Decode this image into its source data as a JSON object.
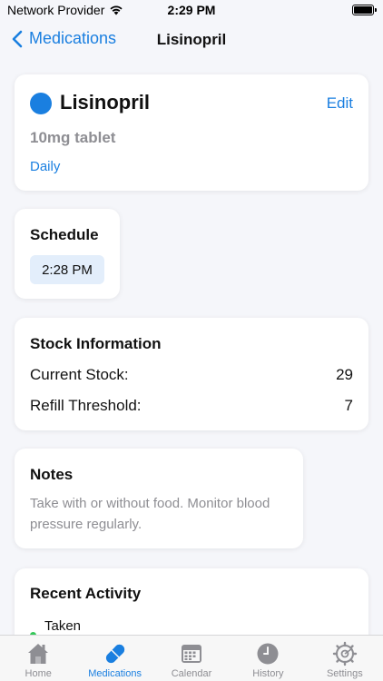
{
  "status_bar": {
    "carrier": "Network Provider",
    "time": "2:29 PM"
  },
  "nav": {
    "back_label": "Medications",
    "title": "Lisinopril"
  },
  "medication": {
    "name": "Lisinopril",
    "edit_label": "Edit",
    "dosage": "10mg tablet",
    "frequency": "Daily",
    "color": "#1a7fe0"
  },
  "schedule": {
    "title": "Schedule",
    "times": [
      "2:28 PM"
    ]
  },
  "stock": {
    "title": "Stock Information",
    "current_label": "Current Stock:",
    "current_value": "29",
    "threshold_label": "Refill Threshold:",
    "threshold_value": "7"
  },
  "notes": {
    "title": "Notes",
    "text": "Take with or without food. Monitor blood pressure regularly."
  },
  "activity": {
    "title": "Recent Activity",
    "items": [
      {
        "label": "Taken",
        "status_color": "#34c759"
      }
    ]
  },
  "tabs": [
    {
      "label": "Home",
      "icon": "house-icon",
      "active": false
    },
    {
      "label": "Medications",
      "icon": "pill-icon",
      "active": true
    },
    {
      "label": "Calendar",
      "icon": "calendar-icon",
      "active": false
    },
    {
      "label": "History",
      "icon": "clock-icon",
      "active": false
    },
    {
      "label": "Settings",
      "icon": "gear-icon",
      "active": false
    }
  ],
  "colors": {
    "accent": "#1a7fe0",
    "background": "#f5f6fa",
    "secondary_text": "#8e8e93",
    "chip_background": "#e3eefb"
  }
}
